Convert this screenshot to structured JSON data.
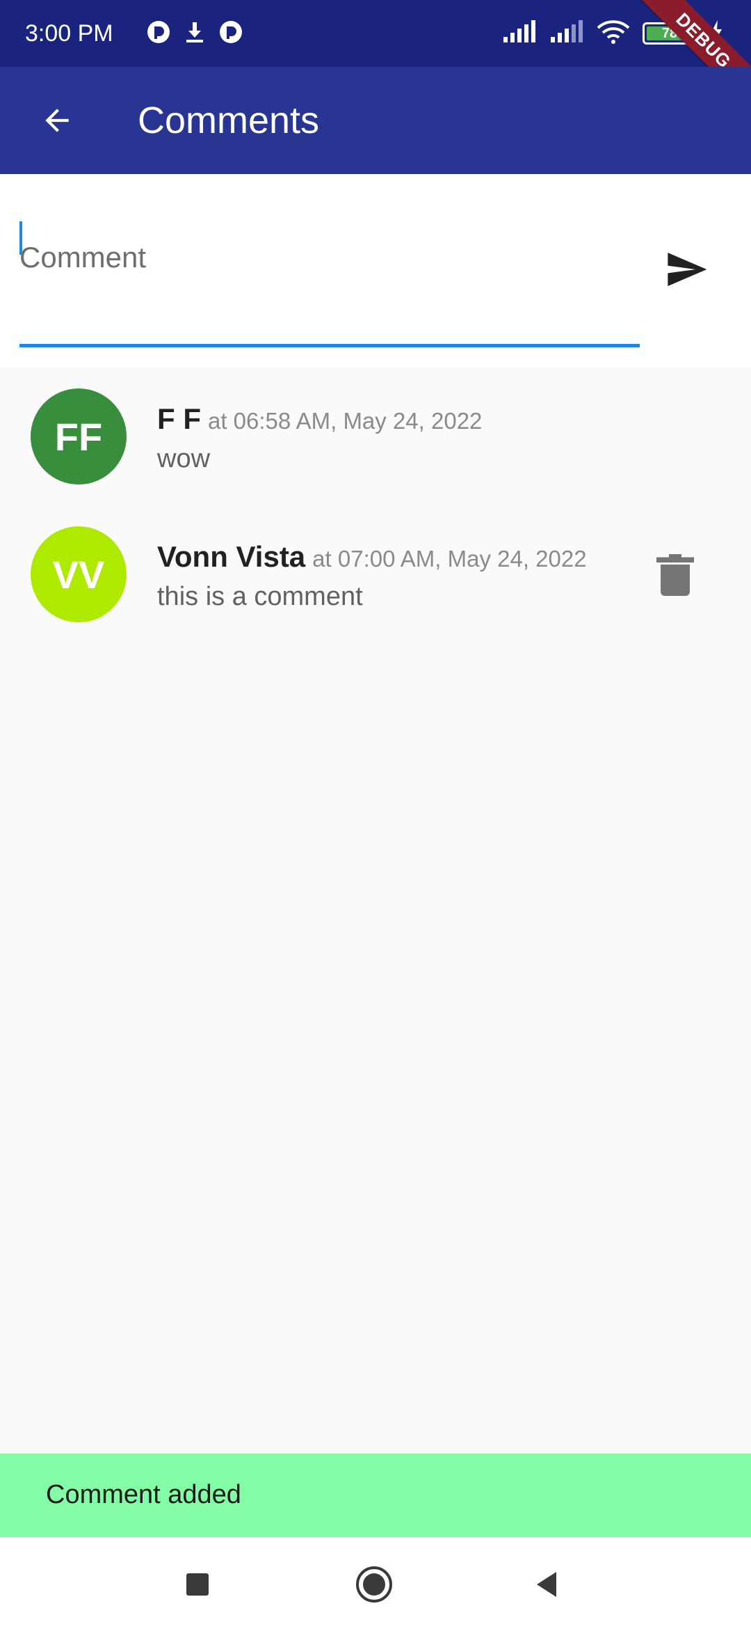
{
  "status_bar": {
    "time": "3:00 PM",
    "battery": "78"
  },
  "debug_banner": "DEBUG",
  "app_bar": {
    "title": "Comments"
  },
  "comment_input": {
    "placeholder": "Comment",
    "value": ""
  },
  "comments": [
    {
      "initials": "FF",
      "name": "F F",
      "time": "at 06:58 AM, May 24, 2022",
      "text": "wow",
      "avatar_color": "#388e3c",
      "deletable": false
    },
    {
      "initials": "VV",
      "name": "Vonn Vista",
      "time": "at 07:00 AM, May 24, 2022",
      "text": "this is a comment",
      "avatar_color": "#aeea00",
      "deletable": true
    }
  ],
  "snackbar": {
    "text": "Comment added",
    "color": "#84fba6"
  },
  "colors": {
    "status_bar": "#1a237e",
    "app_bar": "#283593",
    "accent": "#1e88e5"
  }
}
